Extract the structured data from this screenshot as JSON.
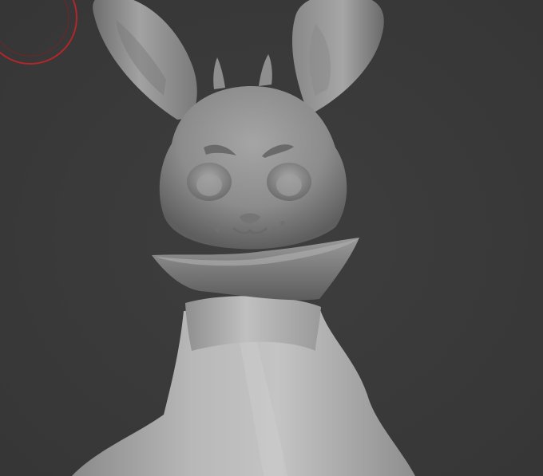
{
  "viewport": {
    "type": "3d-sculpt-canvas",
    "background_color": "#3b3b3b",
    "model_color": "#9a9a9a",
    "brush_cursor_color": "#b3262a"
  },
  "model": {
    "subject": "rabbit bust",
    "parts": [
      "left-ear",
      "right-ear",
      "antenna-left",
      "antenna-right",
      "head",
      "brows",
      "eyes",
      "nose",
      "mouth",
      "collar",
      "neck",
      "body"
    ]
  },
  "brush_cursor": {
    "shape": "double-circle"
  }
}
